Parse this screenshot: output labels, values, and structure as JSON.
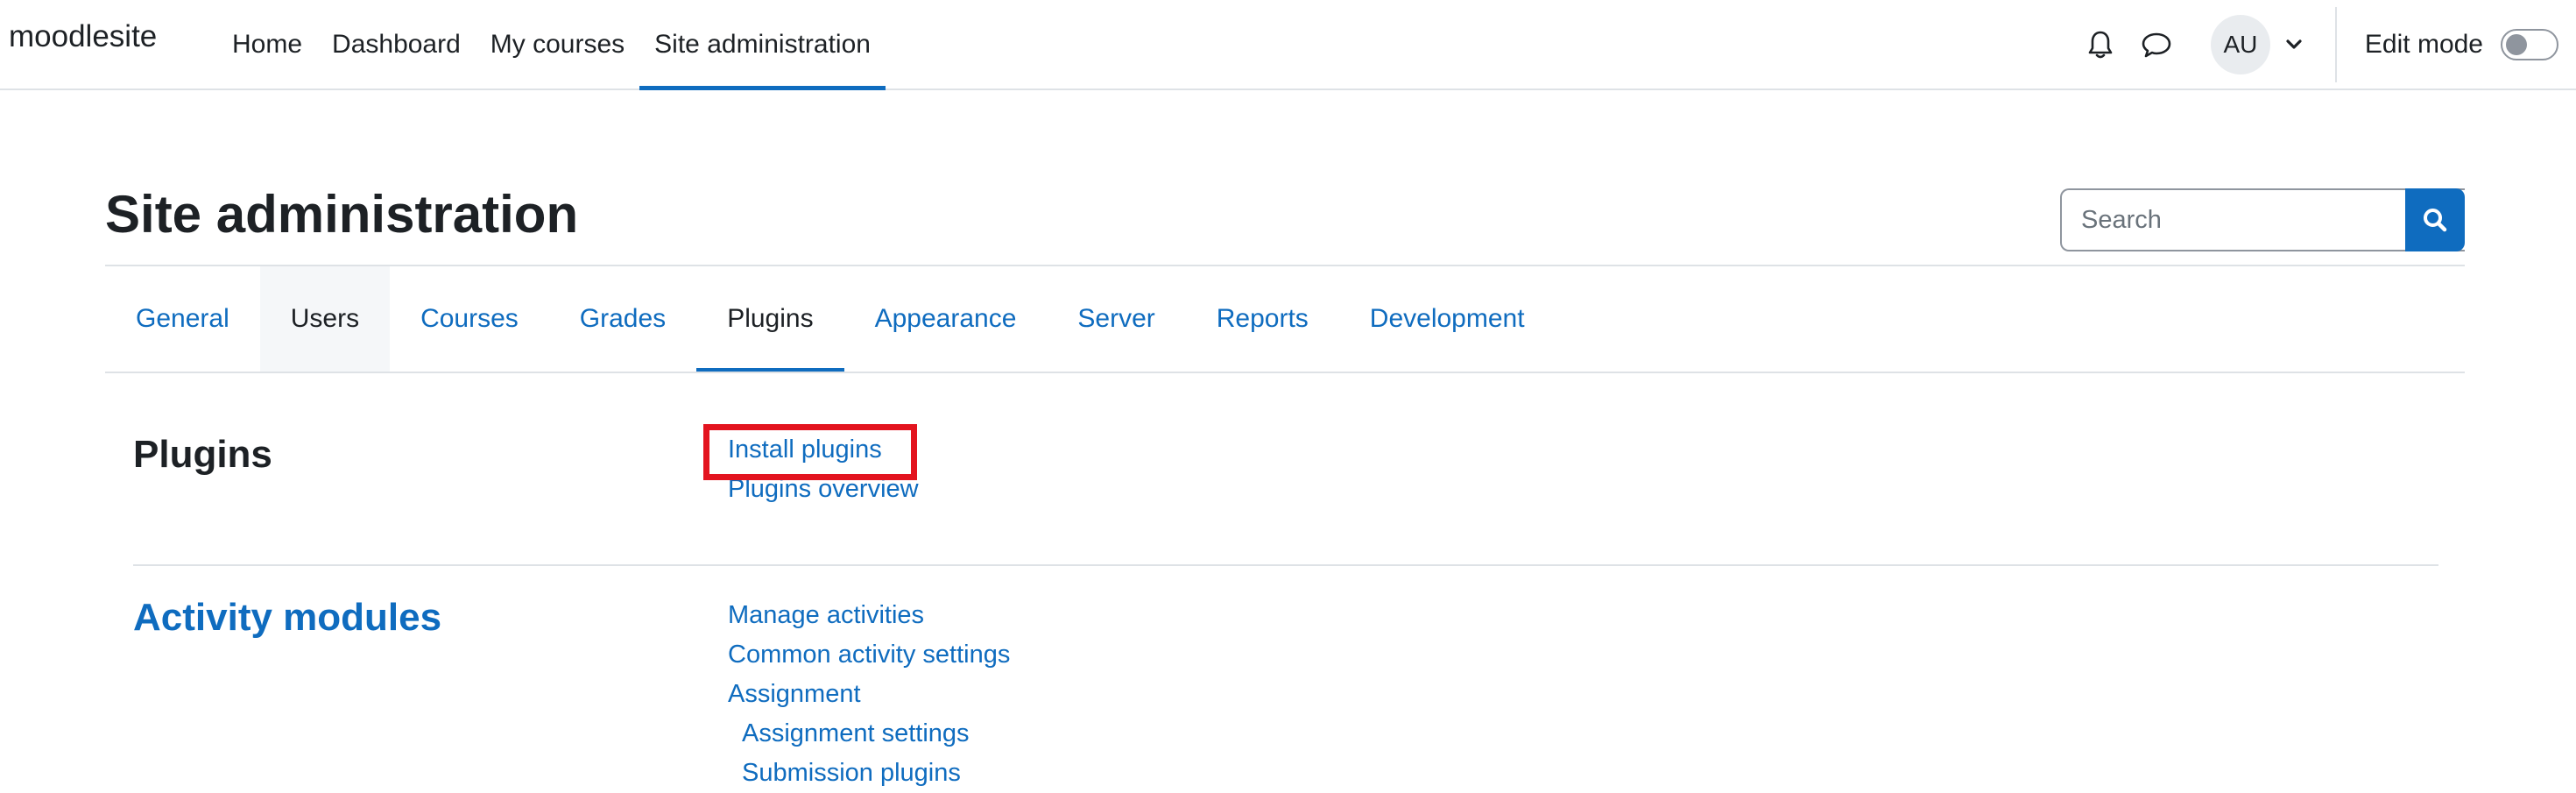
{
  "navbar": {
    "brand": "moodlesite",
    "links": [
      "Home",
      "Dashboard",
      "My courses",
      "Site administration"
    ],
    "active_link": "Site administration",
    "avatar_initials": "AU",
    "edit_mode_label": "Edit mode",
    "edit_mode_on": false
  },
  "header": {
    "title": "Site administration",
    "search_placeholder": "Search"
  },
  "tabs": {
    "items": [
      "General",
      "Users",
      "Courses",
      "Grades",
      "Plugins",
      "Appearance",
      "Server",
      "Reports",
      "Development"
    ],
    "active": "Plugins",
    "hovered": "Users"
  },
  "sections": {
    "plugins": {
      "title": "Plugins",
      "links": [
        "Install plugins",
        "Plugins overview"
      ]
    },
    "activity_modules": {
      "title": "Activity modules",
      "links": [
        "Manage activities",
        "Common activity settings",
        "Assignment"
      ],
      "sublinks": [
        "Assignment settings",
        "Submission plugins"
      ]
    }
  },
  "colors": {
    "link": "#0f6cbf",
    "highlight": "#e3141f",
    "text": "#1d2125"
  }
}
